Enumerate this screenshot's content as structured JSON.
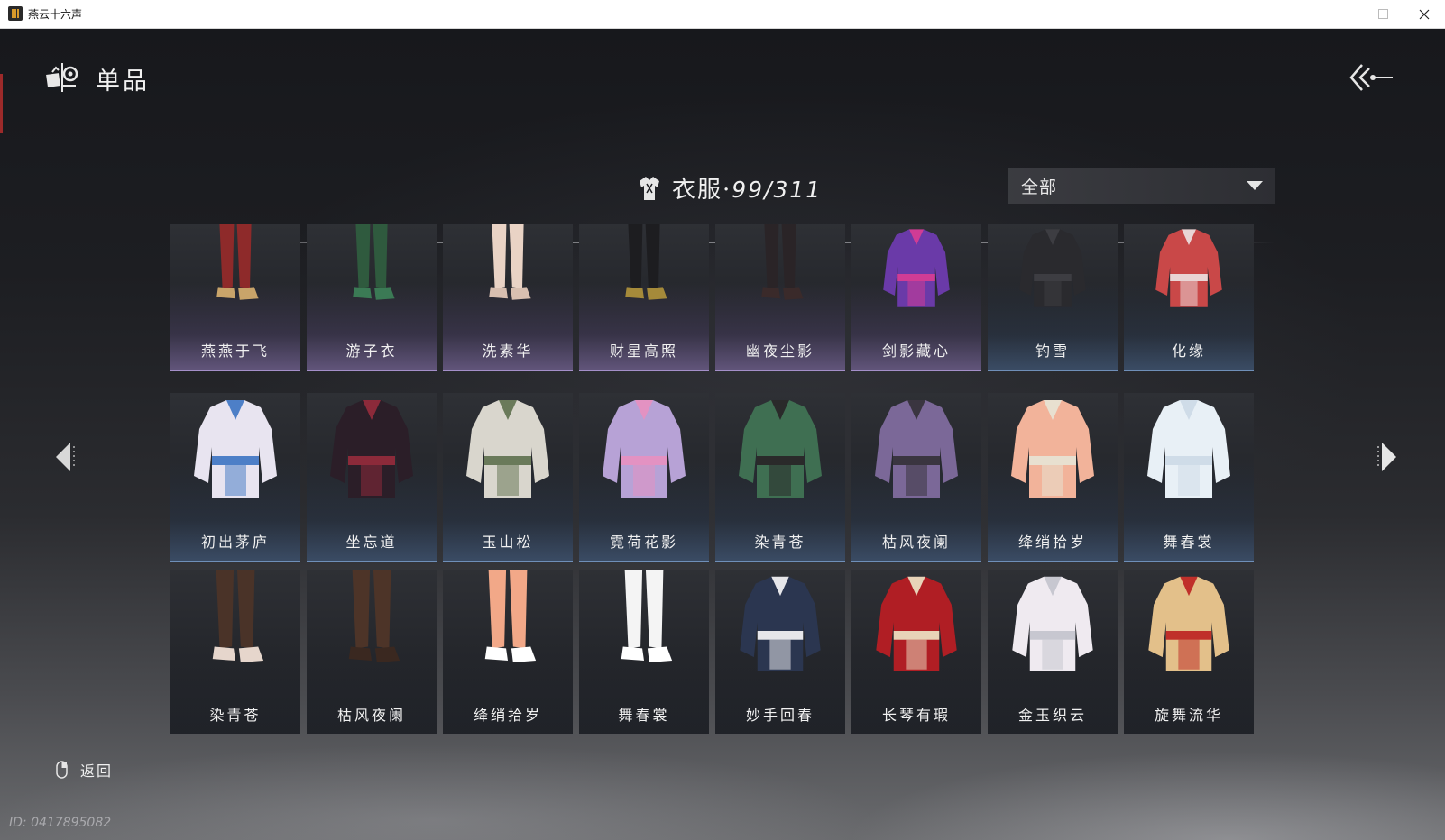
{
  "window": {
    "title": "燕云十六声"
  },
  "header": {
    "title": "单品"
  },
  "category": {
    "label": "衣服",
    "separator": "·",
    "count": "99/311"
  },
  "filter": {
    "selected": "全部"
  },
  "items": [
    {
      "name": "燕燕于飞",
      "rarity": "purple"
    },
    {
      "name": "游子衣",
      "rarity": "purple"
    },
    {
      "name": "洗素华",
      "rarity": "purple"
    },
    {
      "name": "财星高照",
      "rarity": "purple"
    },
    {
      "name": "幽夜尘影",
      "rarity": "purple"
    },
    {
      "name": "剑影藏心",
      "rarity": "purple"
    },
    {
      "name": "钓雪",
      "rarity": "blue"
    },
    {
      "name": "化缘",
      "rarity": "blue"
    },
    {
      "name": "初出茅庐",
      "rarity": "blue"
    },
    {
      "name": "坐忘道",
      "rarity": "blue"
    },
    {
      "name": "玉山松",
      "rarity": "blue"
    },
    {
      "name": "霓荷花影",
      "rarity": "blue"
    },
    {
      "name": "染青苍",
      "rarity": "blue"
    },
    {
      "name": "枯风夜阑",
      "rarity": "blue"
    },
    {
      "name": "绛绡拾岁",
      "rarity": "blue"
    },
    {
      "name": "舞春裳",
      "rarity": "blue"
    },
    {
      "name": "染青苍",
      "rarity": "dark"
    },
    {
      "name": "枯风夜阑",
      "rarity": "dark"
    },
    {
      "name": "绛绡拾岁",
      "rarity": "dark"
    },
    {
      "name": "舞春裳",
      "rarity": "dark"
    },
    {
      "name": "妙手回春",
      "rarity": "dark"
    },
    {
      "name": "长琴有瑕",
      "rarity": "dark"
    },
    {
      "name": "金玉织云",
      "rarity": "dark"
    },
    {
      "name": "旋舞流华",
      "rarity": "dark"
    }
  ],
  "footer": {
    "back_label": "返回",
    "uid": "ID: 0417895082"
  },
  "colors": {
    "purple_rarity": "#a48fc9",
    "blue_rarity": "#6f8fb8",
    "accent_red": "#9c2a2a"
  }
}
